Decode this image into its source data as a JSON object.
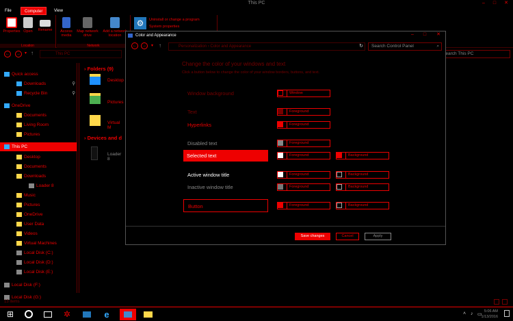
{
  "window": {
    "title": "This PC"
  },
  "ribbon": {
    "tabs": [
      "File",
      "Computer",
      "View"
    ],
    "groups": [
      {
        "label": "Location",
        "items": [
          "Properties",
          "Open",
          "Rename"
        ]
      },
      {
        "label": "Network",
        "items": [
          "Access media",
          "Map network drive",
          "Add a network location"
        ]
      },
      {
        "label": "System",
        "items": [
          "Uninstall or change a program",
          "System properties"
        ]
      }
    ]
  },
  "address": {
    "path": "This PC",
    "search_placeholder": "Search This PC"
  },
  "nav": {
    "items": [
      {
        "label": "Quick access",
        "indent": 0
      },
      {
        "label": "Downloads",
        "indent": 1
      },
      {
        "label": "Recycle Bin",
        "indent": 1
      },
      {
        "label": "OneDrive",
        "indent": 0
      },
      {
        "label": "Documents",
        "indent": 1
      },
      {
        "label": "Living Room",
        "indent": 1
      },
      {
        "label": "Pictures",
        "indent": 1
      },
      {
        "label": "This PC",
        "indent": 0
      },
      {
        "label": "Desktop",
        "indent": 1
      },
      {
        "label": "Documents",
        "indent": 1
      },
      {
        "label": "Downloads",
        "indent": 1
      },
      {
        "label": "Loader 8",
        "indent": 2
      },
      {
        "label": "Music",
        "indent": 1
      },
      {
        "label": "Pictures",
        "indent": 1
      },
      {
        "label": "OneDrive",
        "indent": 1
      },
      {
        "label": "User Data",
        "indent": 1
      },
      {
        "label": "Videos",
        "indent": 1
      },
      {
        "label": "Virtual Machines",
        "indent": 1
      },
      {
        "label": "Local Disk (C:)",
        "indent": 1
      },
      {
        "label": "Local Disk (D:)",
        "indent": 1
      },
      {
        "label": "Local Disk (E:)",
        "indent": 1
      },
      {
        "label": "Local Disk (F:)",
        "indent": 0
      },
      {
        "label": "Local Disk (G:)",
        "indent": 0
      }
    ]
  },
  "content": {
    "folders_header": "Folders (9)",
    "folders": [
      "Desktop",
      "Pictures",
      "Virtual M"
    ],
    "devices_header": "Devices and d",
    "devices": [
      "Loader 8"
    ]
  },
  "dialog": {
    "title": "Color and Appearance",
    "breadcrumb": "Personalization  ›  Color and Appearance",
    "search_placeholder": "Search Control Panel",
    "heading": "Change the color of your windows and text",
    "subheading": "Click a button below to change the color of your window borders, buttons, and text.",
    "rows": [
      {
        "label": "Window background",
        "fg": "Window"
      },
      {
        "label": "Text",
        "fg": "Foreground"
      },
      {
        "label": "Hyperlinks",
        "fg": "Foreground"
      },
      {
        "label": "Disabled text",
        "fg": "Foreground"
      },
      {
        "label": "Selected text",
        "fg": "Foreground",
        "bg": "Background"
      },
      {
        "label": "Active window title",
        "fg": "Foreground",
        "bg": "Background"
      },
      {
        "label": "Inactive window title",
        "fg": "Foreground",
        "bg": "Background"
      },
      {
        "label": "Button",
        "fg": "Foreground",
        "bg": "Background"
      }
    ],
    "save_label": "Save changes",
    "cancel_label": "Cancel",
    "apply_label": "Apply"
  },
  "status": {
    "items_count": "13 items"
  },
  "taskbar": {
    "time": "5:06 AM",
    "date": "1/13/2016"
  },
  "colors": {
    "accent": "#ee0000",
    "background": "#000000"
  }
}
